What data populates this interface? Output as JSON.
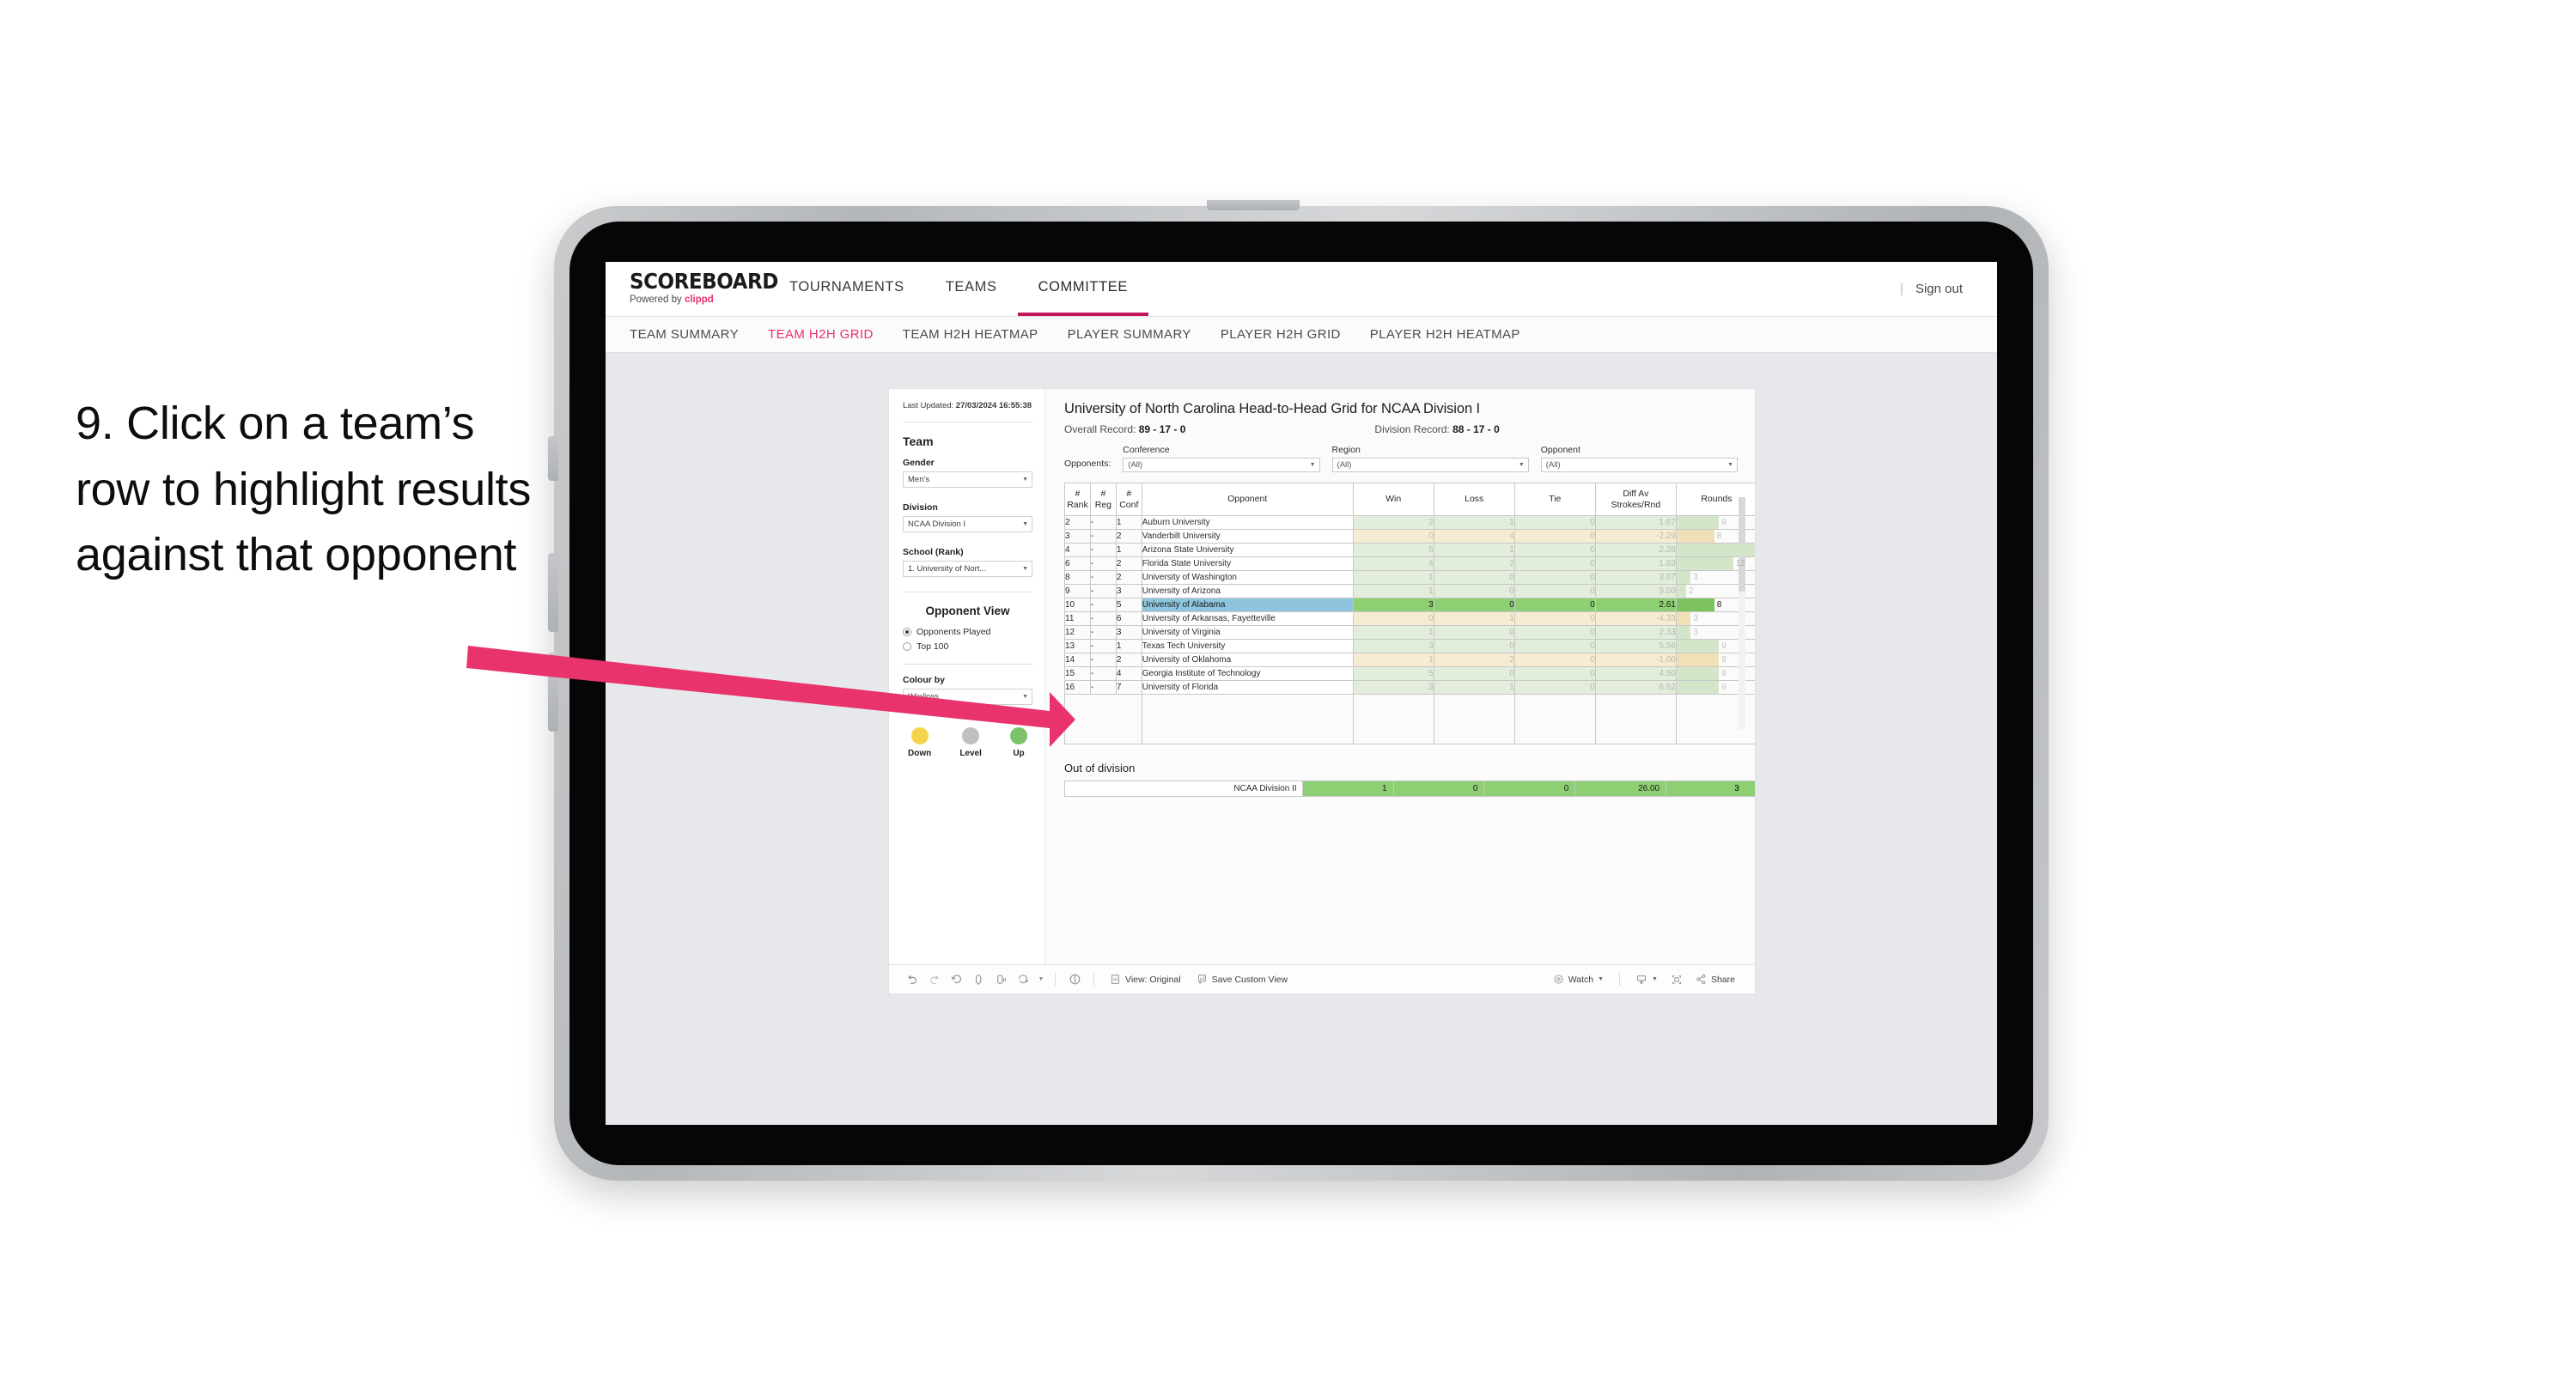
{
  "annotation": {
    "text": "9. Click on a team’s row to highlight results against that opponent",
    "arrow_color": "#e8336d"
  },
  "header": {
    "logo": "SCOREBOARD",
    "logo_sub_prefix": "Powered by ",
    "logo_sub_brand": "clippd",
    "nav": [
      {
        "label": "TOURNAMENTS",
        "active": false
      },
      {
        "label": "TEAMS",
        "active": false
      },
      {
        "label": "COMMITTEE",
        "active": true
      }
    ],
    "divider": "|",
    "sign_out": "Sign out"
  },
  "sub_nav": [
    {
      "label": "TEAM SUMMARY",
      "active": false
    },
    {
      "label": "TEAM H2H GRID",
      "active": true
    },
    {
      "label": "TEAM H2H HEATMAP",
      "active": false
    },
    {
      "label": "PLAYER SUMMARY",
      "active": false
    },
    {
      "label": "PLAYER H2H GRID",
      "active": false
    },
    {
      "label": "PLAYER H2H HEATMAP",
      "active": false
    }
  ],
  "sidebar": {
    "last_updated_label": "Last Updated: ",
    "last_updated_value": "27/03/2024 16:55:38",
    "team_heading": "Team",
    "gender_label": "Gender",
    "gender_value": "Men’s",
    "division_label": "Division",
    "division_value": "NCAA Division I",
    "school_label": "School (Rank)",
    "school_value": "1. University of Nort...",
    "opponent_view_heading": "Opponent View",
    "opponent_view_options": [
      {
        "label": "Opponents Played",
        "selected": true
      },
      {
        "label": "Top 100",
        "selected": false
      }
    ],
    "colour_by_label": "Colour by",
    "colour_by_value": "Win/loss",
    "legend": [
      {
        "label": "Down",
        "color": "#f4d44d"
      },
      {
        "label": "Level",
        "color": "#bfc0c2"
      },
      {
        "label": "Up",
        "color": "#7cc26a"
      }
    ]
  },
  "viz": {
    "title": "University of North Carolina Head-to-Head Grid for NCAA Division I",
    "overall_record_label": "Overall Record: ",
    "overall_record_value": "89 - 17 - 0",
    "division_record_label": "Division Record: ",
    "division_record_value": "88 - 17 - 0",
    "opponents_label": "Opponents:",
    "filters": [
      {
        "caption": "Conference",
        "value": "(All)"
      },
      {
        "caption": "Region",
        "value": "(All)"
      },
      {
        "caption": "Opponent",
        "value": "(All)"
      }
    ],
    "out_of_division_title": "Out of division"
  },
  "chart_data": {
    "type": "table",
    "title": "University of North Carolina Head-to-Head Grid for NCAA Division I",
    "columns": [
      "# Rank",
      "# Reg",
      "# Conf",
      "Opponent",
      "Win",
      "Loss",
      "Tie",
      "Diff Av Strokes/Rnd",
      "Rounds"
    ],
    "column_headers_multiline": [
      {
        "l1": "#",
        "l2": "Rank"
      },
      {
        "l1": "#",
        "l2": "Reg"
      },
      {
        "l1": "#",
        "l2": "Conf"
      },
      {
        "l1": "",
        "l2": "Opponent"
      },
      {
        "l1": "",
        "l2": "Win"
      },
      {
        "l1": "",
        "l2": "Loss"
      },
      {
        "l1": "",
        "l2": "Tie"
      },
      {
        "l1": "Diff Av",
        "l2": "Strokes/Rnd"
      },
      {
        "l1": "",
        "l2": "Rounds"
      }
    ],
    "rounds_max": 17,
    "rows": [
      {
        "rank": "2",
        "reg": "-",
        "conf": "1",
        "opponent": "Auburn University",
        "win": "2",
        "loss": "1",
        "tie": "0",
        "diff": "1.67",
        "rounds": "9",
        "tone": "up",
        "highlighted": false
      },
      {
        "rank": "3",
        "reg": "-",
        "conf": "2",
        "opponent": "Vanderbilt University",
        "win": "0",
        "loss": "4",
        "tie": "0",
        "diff": "-2.29",
        "rounds": "8",
        "tone": "down",
        "highlighted": false
      },
      {
        "rank": "4",
        "reg": "-",
        "conf": "1",
        "opponent": "Arizona State University",
        "win": "5",
        "loss": "1",
        "tie": "0",
        "diff": "2.28",
        "rounds": "17",
        "tone": "up",
        "highlighted": false
      },
      {
        "rank": "6",
        "reg": "-",
        "conf": "2",
        "opponent": "Florida State University",
        "win": "4",
        "loss": "2",
        "tie": "0",
        "diff": "1.83",
        "rounds": "12",
        "tone": "up",
        "highlighted": false
      },
      {
        "rank": "8",
        "reg": "-",
        "conf": "2",
        "opponent": "University of Washington",
        "win": "1",
        "loss": "0",
        "tie": "0",
        "diff": "3.67",
        "rounds": "3",
        "tone": "up",
        "highlighted": false
      },
      {
        "rank": "9",
        "reg": "-",
        "conf": "3",
        "opponent": "University of Arizona",
        "win": "1",
        "loss": "0",
        "tie": "0",
        "diff": "9.00",
        "rounds": "2",
        "tone": "up",
        "highlighted": false
      },
      {
        "rank": "10",
        "reg": "-",
        "conf": "5",
        "opponent": "University of Alabama",
        "win": "3",
        "loss": "0",
        "tie": "0",
        "diff": "2.61",
        "rounds": "8",
        "tone": "up",
        "highlighted": true
      },
      {
        "rank": "11",
        "reg": "-",
        "conf": "6",
        "opponent": "University of Arkansas, Fayetteville",
        "win": "0",
        "loss": "1",
        "tie": "0",
        "diff": "-4.33",
        "rounds": "3",
        "tone": "down",
        "highlighted": false
      },
      {
        "rank": "12",
        "reg": "-",
        "conf": "3",
        "opponent": "University of Virginia",
        "win": "1",
        "loss": "0",
        "tie": "0",
        "diff": "2.33",
        "rounds": "3",
        "tone": "up",
        "highlighted": false
      },
      {
        "rank": "13",
        "reg": "-",
        "conf": "1",
        "opponent": "Texas Tech University",
        "win": "3",
        "loss": "0",
        "tie": "0",
        "diff": "5.56",
        "rounds": "9",
        "tone": "up",
        "highlighted": false
      },
      {
        "rank": "14",
        "reg": "-",
        "conf": "2",
        "opponent": "University of Oklahoma",
        "win": "1",
        "loss": "2",
        "tie": "0",
        "diff": "-1.00",
        "rounds": "9",
        "tone": "down",
        "highlighted": false
      },
      {
        "rank": "15",
        "reg": "-",
        "conf": "4",
        "opponent": "Georgia Institute of Technology",
        "win": "5",
        "loss": "0",
        "tie": "0",
        "diff": "4.50",
        "rounds": "9",
        "tone": "up",
        "highlighted": false
      },
      {
        "rank": "16",
        "reg": "-",
        "conf": "7",
        "opponent": "University of Florida",
        "win": "3",
        "loss": "1",
        "tie": "0",
        "diff": "6.62",
        "rounds": "9",
        "tone": "up",
        "highlighted": false
      }
    ],
    "out_of_division": {
      "label": "NCAA Division II",
      "win": "1",
      "loss": "0",
      "tie": "0",
      "diff": "26.00",
      "rounds": "3"
    }
  },
  "toolbar": {
    "view_label": "View: Original",
    "save_label": "Save Custom View",
    "watch_label": "Watch",
    "share_label": "Share"
  }
}
